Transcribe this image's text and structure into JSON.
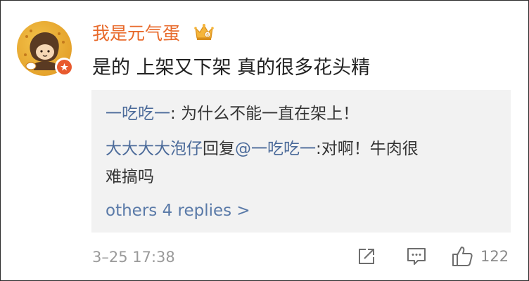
{
  "comment": {
    "username": "我是元气蛋",
    "text": "是的 上架又下架 真的很多花头精",
    "timestamp": "3–25 17:38",
    "like_count": "122"
  },
  "replies": {
    "first": {
      "user": "一吃吃一",
      "separator": ": ",
      "text": "为什么不能一直在架上！"
    },
    "second": {
      "user": "大大大大泡仔",
      "middle": "回复",
      "mention": "@一吃吃一",
      "separator": ":",
      "text_line1": "对啊！牛肉很",
      "text_line2": "难搞吗"
    },
    "more_label": "others 4 replies >"
  },
  "colors": {
    "username": "#e86a2b",
    "link_blue": "#4c6b9a",
    "reply_bg": "#f2f2f2",
    "meta_gray": "#9a9a9a"
  },
  "icons": {
    "avatar_badge": "verified-badge-icon",
    "user_badge": "crown-icon",
    "share": "share-icon",
    "comment": "comment-icon",
    "like": "thumbs-up-icon"
  }
}
